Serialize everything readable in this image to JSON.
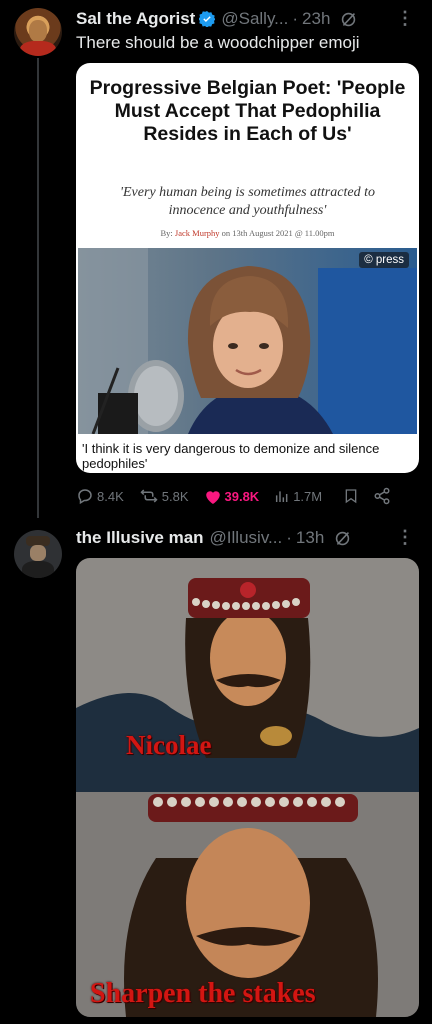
{
  "tweet1": {
    "display_name": "Sal the Agorist",
    "handle": "@Sally...",
    "time": "23h",
    "text": "There should be a woodchipper emoji",
    "card": {
      "headline": "Progressive Belgian Poet: 'People Must Accept That Pedophilia Resides in Each of Us'",
      "subheadline": "'Every human being is sometimes attracted to innocence and youthfulness'",
      "byline_prefix": "By:",
      "author": "Jack Murphy",
      "byline_suffix": "on 13th August 2021 @ 11.00pm",
      "photo_credit": "© press",
      "caption": "'I think it is very dangerous to demonize and silence pedophiles'"
    },
    "actions": {
      "replies": "8.4K",
      "reposts": "5.8K",
      "likes": "39.8K",
      "views": "1.7M"
    }
  },
  "tweet2": {
    "display_name": "the Illusive man",
    "handle": "@Illusiv...",
    "time": "13h",
    "meme": {
      "top_caption": "Nicolae",
      "bottom_caption": "Sharpen the stakes"
    }
  },
  "colors": {
    "background": "#000000",
    "text": "#e7e9ea",
    "muted": "#71767b",
    "verified": "#1d9bf0",
    "like": "#f91880",
    "meme_caption": "#d31612"
  }
}
